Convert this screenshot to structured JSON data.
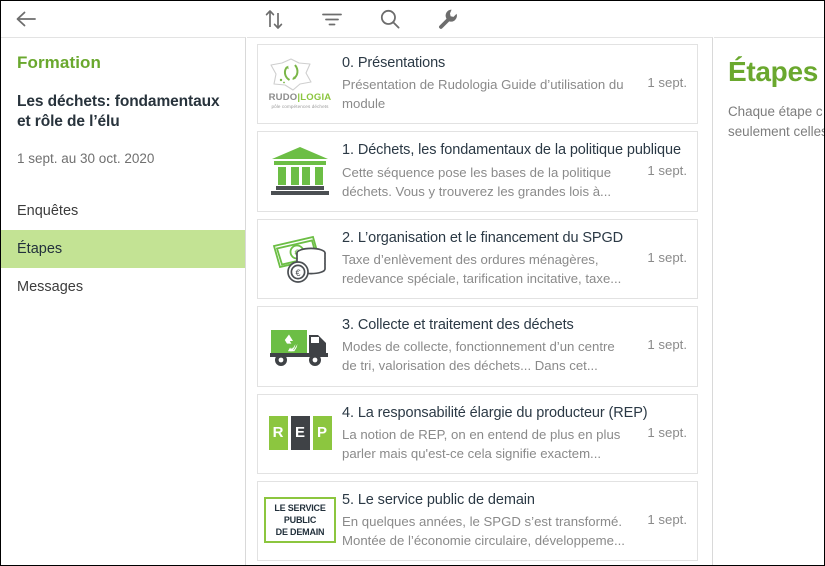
{
  "topbar": {
    "back_label": "←",
    "back_name": "back-arrow-icon",
    "tools": [
      {
        "name": "sort-icon",
        "label": "Trier"
      },
      {
        "name": "filter-icon",
        "label": "Filtrer"
      },
      {
        "name": "search-icon",
        "label": "Rechercher"
      },
      {
        "name": "wrench-icon",
        "label": "Outils"
      }
    ]
  },
  "sidebar": {
    "kicker": "Formation",
    "title": "Les déchets: fondamentaux et rôle de l’élu",
    "dates": "1 sept. au 30 oct. 2020",
    "items": [
      {
        "label": "Enquêtes",
        "active": false
      },
      {
        "label": "Étapes",
        "active": true
      },
      {
        "label": "Messages",
        "active": false
      }
    ]
  },
  "list": {
    "items": [
      {
        "icon": "rudologia-logo",
        "title": "0. Présentations",
        "description": "Présentation de Rudologia Guide d’utilisation du module",
        "date": "1 sept."
      },
      {
        "icon": "bank-building-icon",
        "title": "1. Déchets, les fondamentaux de la politique publique",
        "description": "Cette séquence pose les bases de la politique déchets. Vous y trouverez les grandes lois à...",
        "date": "1 sept."
      },
      {
        "icon": "money-euro-icon",
        "title": "2. L’organisation et le financement du SPGD",
        "description": "Taxe d’enlèvement des ordures ménagères, redevance spéciale, tarification incitative, taxe...",
        "date": "1 sept."
      },
      {
        "icon": "recycling-truck-icon",
        "title": "3. Collecte et traitement des déchets",
        "description": "Modes de collecte, fonctionnement d’un centre de tri, valorisation des déchets... Dans cet...",
        "date": "1 sept."
      },
      {
        "icon": "rep-letters-icon",
        "title": "4. La responsabilité élargie du producteur (REP)",
        "description": "La notion de REP, on en entend de plus en plus parler mais qu'est-ce cela signifie exactem...",
        "date": "1 sept."
      },
      {
        "icon": "service-public-demain-icon",
        "title": "5. Le service public de demain",
        "description": "En quelques années, le SPGD s’est transformé. Montée de l’économie circulaire, développeme...",
        "date": "1 sept."
      }
    ]
  },
  "right_pane": {
    "title": "Étapes",
    "line1": "Chaque étape c",
    "line2": "seulement celles"
  },
  "icons": {
    "rep_letters": [
      "R",
      "E",
      "P"
    ],
    "service_public_lines": [
      "LE SERVICE",
      "PUBLIC",
      "DE DEMAIN"
    ],
    "logo_rudo": "RUDO",
    "logo_bar": "|",
    "logo_logia": "LOGIA",
    "logo_tagline": "pôle compétences déchets"
  },
  "colors": {
    "brand_green": "#6aa82e",
    "accent_green": "#8cc63f",
    "selection_green": "#c3e394",
    "title_dark": "#2b3945",
    "muted_gray": "#8a8a8a"
  }
}
